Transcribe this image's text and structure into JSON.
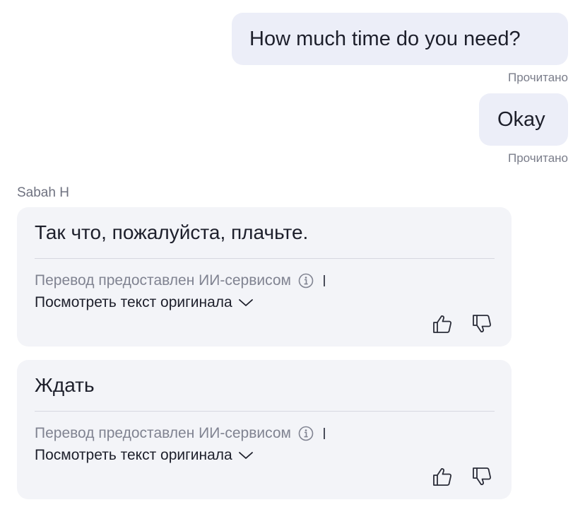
{
  "outgoing": [
    {
      "text": "How much time do you need?",
      "status": "Прочитано"
    },
    {
      "text": "Okay",
      "status": "Прочитано"
    }
  ],
  "incoming": {
    "sender": "Sabah H",
    "messages": [
      {
        "text": "Так что, пожалуйста, плачьте.",
        "translation_note": "Перевод предоставлен ИИ-сервисом",
        "show_original": "Посмотреть текст оригинала",
        "icons": [
          "info-icon",
          "chevron-down-icon",
          "thumbs-up-icon",
          "thumbs-down-icon"
        ]
      },
      {
        "text": "Ждать",
        "translation_note": "Перевод предоставлен ИИ-сервисом",
        "show_original": "Посмотреть текст оригинала",
        "icons": [
          "info-icon",
          "chevron-down-icon",
          "thumbs-up-icon",
          "thumbs-down-icon"
        ]
      }
    ]
  },
  "colors": {
    "outgoing_bubble": "#eceef8",
    "incoming_bubble": "#f3f4f8",
    "text": "#1d1f2b",
    "muted": "#808391"
  }
}
